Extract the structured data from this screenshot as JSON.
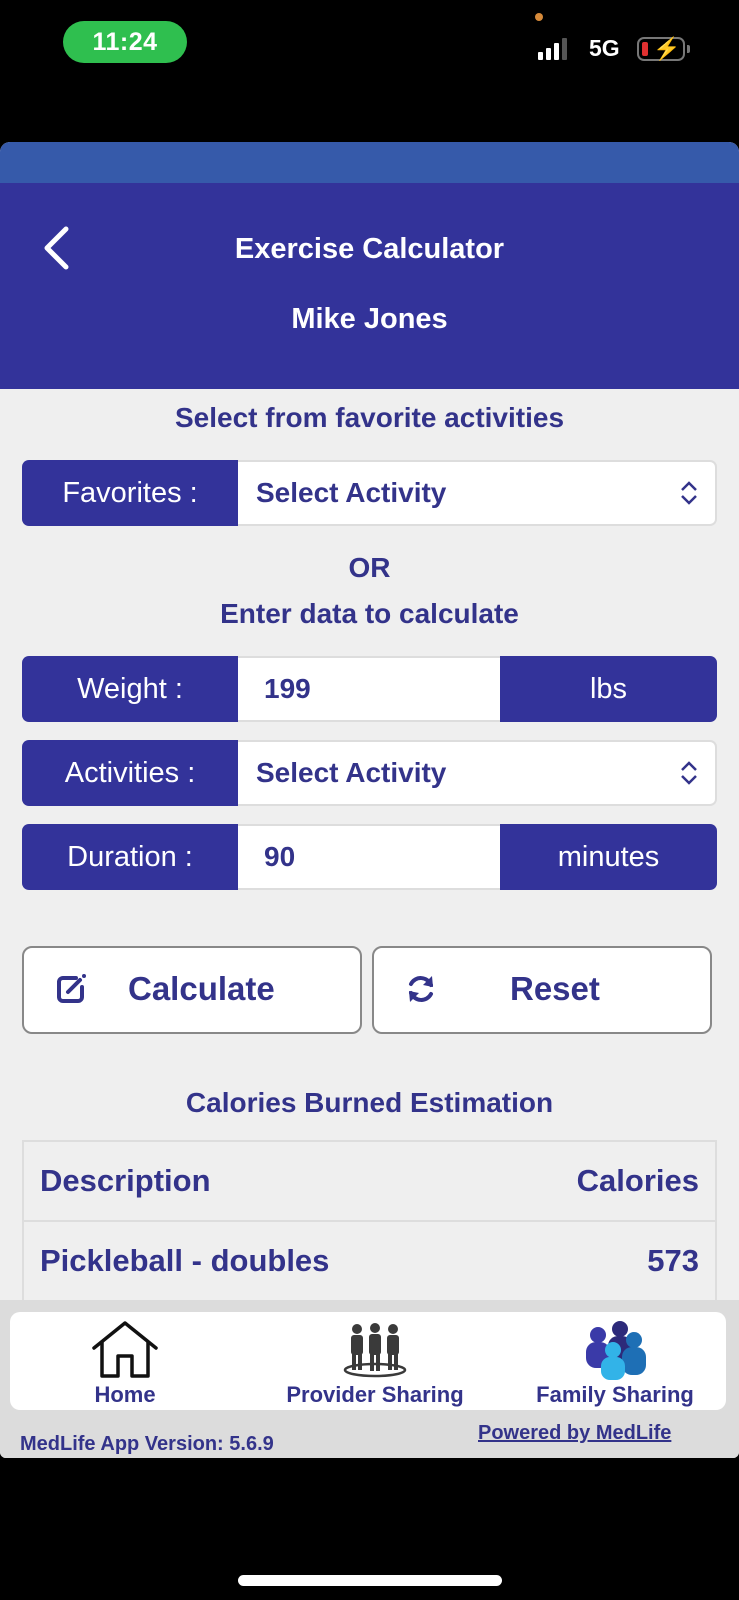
{
  "status_bar": {
    "time": "11:24",
    "network": "5G",
    "signal_bars_active": 3,
    "signal_bars_total": 4,
    "battery_icon": "battery-charging-low-icon"
  },
  "header": {
    "back_icon": "chevron-left-icon",
    "title": "Exercise Calculator",
    "subtitle": "Mike Jones"
  },
  "favorites_section": {
    "title": "Select from favorite activities",
    "label": "Favorites :",
    "value": "Select Activity",
    "icon": "select-chevrons-icon"
  },
  "divider": {
    "or_text": "OR",
    "enter_text": "Enter data to calculate"
  },
  "form": {
    "weight": {
      "label": "Weight :",
      "value": "199",
      "unit": "lbs"
    },
    "activities": {
      "label": "Activities :",
      "value": "Select Activity"
    },
    "duration": {
      "label": "Duration :",
      "value": "90",
      "unit": "minutes"
    }
  },
  "buttons": {
    "calculate": {
      "label": "Calculate",
      "icon": "edit-icon"
    },
    "reset": {
      "label": "Reset",
      "icon": "refresh-icon"
    }
  },
  "results": {
    "title": "Calories Burned Estimation",
    "columns": [
      "Description",
      "Calories"
    ],
    "rows": [
      {
        "description": "Pickleball - doubles",
        "calories": "573"
      }
    ]
  },
  "bottom_nav": {
    "items": [
      {
        "label": "Home",
        "icon": "home-icon"
      },
      {
        "label": "Provider Sharing",
        "icon": "provider-group-icon"
      },
      {
        "label": "Family Sharing",
        "icon": "family-group-icon"
      }
    ]
  },
  "footer": {
    "version": "MedLife App Version: 5.6.9",
    "powered_by": "Powered by MedLife"
  },
  "colors": {
    "primary": "#33339a",
    "accent_strip": "#365aaa",
    "text_primary": "#33338a",
    "background": "#efefef",
    "time_pill": "#2fbf4f"
  }
}
